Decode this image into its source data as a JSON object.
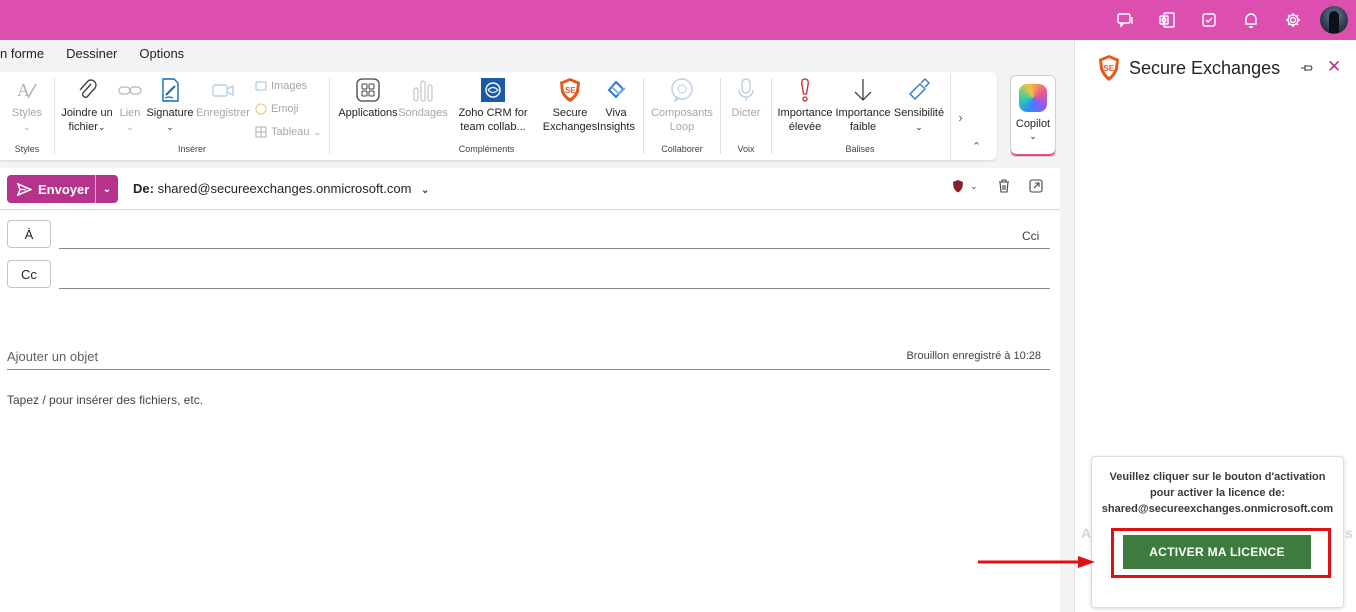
{
  "topbar": {
    "icons": [
      "chat-icon",
      "outlook-icon",
      "tasks-icon",
      "bell-icon",
      "gear-icon"
    ],
    "color": "#dc4fae"
  },
  "menu": {
    "tabs": [
      "n forme",
      "Dessiner",
      "Options"
    ]
  },
  "ribbon": {
    "styles": {
      "label": "Styles",
      "group": "Styles"
    },
    "inserer": {
      "group": "Insérer",
      "joindre": "Joindre un fichier",
      "lien": "Lien",
      "signature": "Signature",
      "enregistrer": "Enregistrer",
      "images": "Images",
      "emoji": "Emoji",
      "tableau": "Tableau"
    },
    "complements": {
      "group": "Compléments",
      "applications": "Applications",
      "sondages": "Sondages",
      "zoho": "Zoho CRM for team collab...",
      "secure": "Secure Exchanges",
      "viva": "Viva Insights"
    },
    "collaborer": {
      "group": "Collaborer",
      "loop": "Composants Loop"
    },
    "voix": {
      "group": "Voix",
      "dicter": "Dicter"
    },
    "balises": {
      "group": "Balises",
      "high": "Importance élevée",
      "low": "Importance faible",
      "sens": "Sensibilité"
    },
    "copilot": "Copilot"
  },
  "compose": {
    "send": "Envoyer",
    "from_label": "De:",
    "from_value": "shared@secureexchanges.onmicrosoft.com",
    "to": "À",
    "cc": "Cc",
    "cci": "Cci",
    "subject_placeholder": "Ajouter un objet",
    "draft_status": "Brouillon enregistré à 10:28",
    "body_hint": "Tapez / pour insérer des fichiers, etc."
  },
  "panel": {
    "title": "Secure Exchanges",
    "message": "Veuillez cliquer sur le bouton d'activation pour activer la licence de:",
    "email": "shared@secureexchanges.onmicrosoft.com",
    "activate": "ACTIVER MA LICENCE",
    "accent": "#3e7b3e",
    "highlight_color": "#e01010"
  }
}
